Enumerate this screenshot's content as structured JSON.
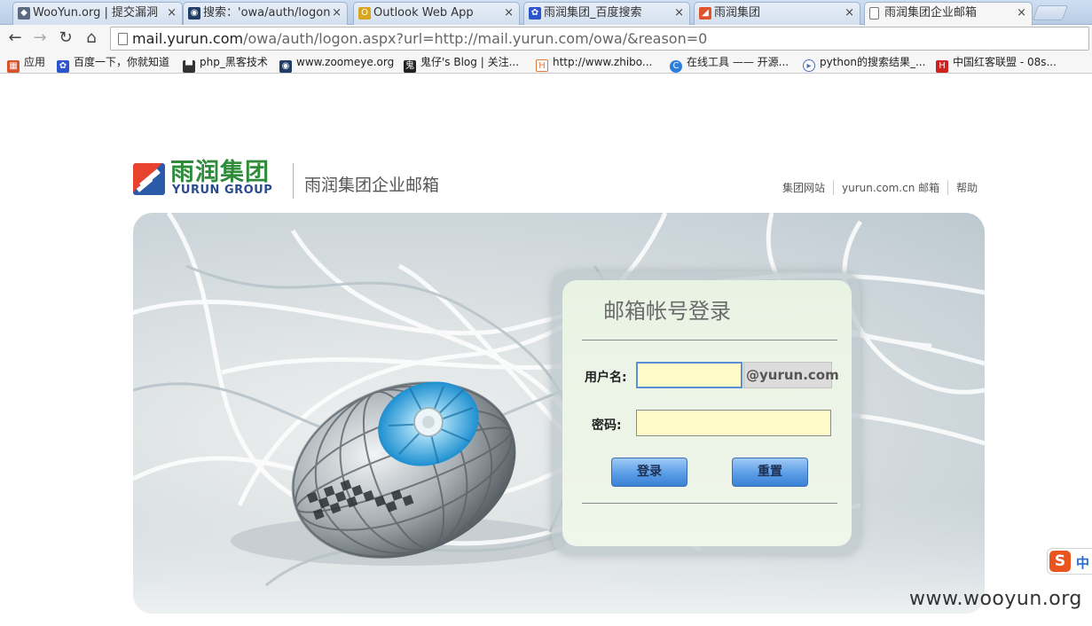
{
  "browser": {
    "tabs": [
      {
        "title": "WooYun.org | 提交漏洞",
        "icon": "wooyun-icon",
        "color": "#5a6a80"
      },
      {
        "title": "搜索：'owa/auth/logon",
        "icon": "zoomeye-icon",
        "color": "#1f3d66"
      },
      {
        "title": "Outlook Web App",
        "icon": "outlook-icon",
        "color": "#d9a520"
      },
      {
        "title": "雨润集团_百度搜索",
        "icon": "baidu-icon",
        "color": "#2b55c9"
      },
      {
        "title": "雨润集团",
        "icon": "yurun-icon",
        "color": "#e0532d"
      },
      {
        "title": "雨润集团企业邮箱",
        "icon": "page-icon",
        "color": "#ffffff"
      }
    ],
    "close_glyph": "×",
    "url_host": "mail.yurun.com",
    "url_rest": "/owa/auth/logon.aspx?url=http://mail.yurun.com/owa/&reason=0",
    "bookmarks": [
      {
        "label": "应用",
        "icon": "apps-icon",
        "color": "#d9532c"
      },
      {
        "label": "百度一下，你就知道",
        "icon": "baidu-icon",
        "color": "#2b55c9"
      },
      {
        "label": "php_黑客技术",
        "icon": "hat-icon",
        "color": "#333333"
      },
      {
        "label": "www.zoomeye.org",
        "icon": "zoomeye-icon",
        "color": "#1f3d66"
      },
      {
        "label": "鬼仔's Blog | 关注...",
        "icon": "ghost-icon",
        "color": "#222222"
      },
      {
        "label": "http://www.zhibo...",
        "icon": "h-icon",
        "color": "#e07a3a"
      },
      {
        "label": "在线工具 —— 开源...",
        "icon": "tool-icon",
        "color": "#2b7de0"
      },
      {
        "label": "python的搜索结果_...",
        "icon": "play-icon",
        "color": "#4a6fb5"
      },
      {
        "label": "中国红客联盟 - 08s...",
        "icon": "redhacker-icon",
        "color": "#cc2222"
      }
    ]
  },
  "header": {
    "logo_cn": "雨润集团",
    "logo_en": "YURUN GROUP",
    "site_title": "雨润集团企业邮箱",
    "links": [
      "集团网站",
      "yurun.com.cn 邮箱",
      "帮助"
    ]
  },
  "login": {
    "title": "邮箱帐号登录",
    "username_label": "用户名:",
    "username_value": "",
    "domain_suffix": "@yurun.com",
    "password_label": "密码:",
    "password_value": "",
    "login_button": "登录",
    "reset_button": "重置"
  },
  "ime": {
    "logo": "S",
    "mode": "中"
  },
  "watermark": "www.wooyun.org",
  "colors": {
    "accent_green": "#2e8b3a",
    "accent_blue": "#2a4c8c",
    "input_bg": "#fffac8",
    "button_blue": "#5b9de6"
  }
}
